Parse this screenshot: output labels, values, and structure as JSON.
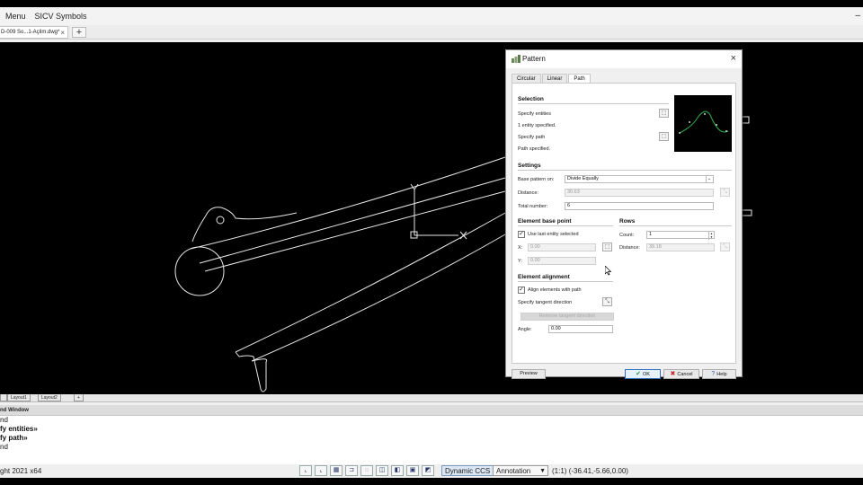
{
  "menubar": {
    "items": [
      "Menu",
      "SICV Symbols"
    ],
    "minimize_glyph": "–"
  },
  "tabs": {
    "doc_tab_label": "D-009 So...1-Açlim.dwg*",
    "doc_tab_close": "×",
    "add_tab": "+"
  },
  "layout_tabs": [
    "Layout1",
    "Layout2",
    "+"
  ],
  "command_window": {
    "title": "nd Window",
    "lines": [
      "nd",
      "fy entities»",
      "fy path»",
      "nd"
    ]
  },
  "statusbar": {
    "app_text": "ght 2021 x64",
    "dynamic_ccs": "Dynamic CCS",
    "annotation": "Annotation",
    "scale": "(1:1)",
    "coordinates": "(-36.41,-5.66,0.00)"
  },
  "dialog": {
    "title": "Pattern",
    "close_glyph": "×",
    "tabs": [
      "Circular",
      "Linear",
      "Path"
    ],
    "active_tab": "Path",
    "selection": {
      "heading": "Selection",
      "specify_entities": "Specify entities",
      "entities_status": "1 entity specified.",
      "specify_path": "Specify path",
      "path_status": "Path specified."
    },
    "settings": {
      "heading": "Settings",
      "base_pattern_label": "Base pattern on:",
      "base_pattern_value": "Divide Equally",
      "distance_label": "Distance:",
      "distance_value": "30.63",
      "total_number_label": "Total number:",
      "total_number_value": "6"
    },
    "base_point": {
      "heading": "Element base point",
      "use_last_label": "Use last entity selected",
      "use_last_checked": true,
      "x_label": "X:",
      "x_value": "0.00",
      "y_label": "Y:",
      "y_value": "0.00"
    },
    "rows": {
      "heading": "Rows",
      "count_label": "Count:",
      "count_value": "1",
      "distance_label": "Distance:",
      "distance_value": "39.18"
    },
    "alignment": {
      "heading": "Element alignment",
      "align_label": "Align elements with path",
      "align_checked": true,
      "tangent_label": "Specify tangent direction",
      "remove_tangent": "Remove tangent direction",
      "angle_label": "Angle:",
      "angle_value": "0.00"
    },
    "buttons": {
      "preview": "Preview",
      "ok": "OK",
      "cancel": "Cancel",
      "help": "Help"
    }
  },
  "colors": {
    "canvas": "#000000",
    "ok_border": "#2d6fbb",
    "cancel_icon": "#cc2222",
    "ok_icon": "#2e9b2e"
  }
}
